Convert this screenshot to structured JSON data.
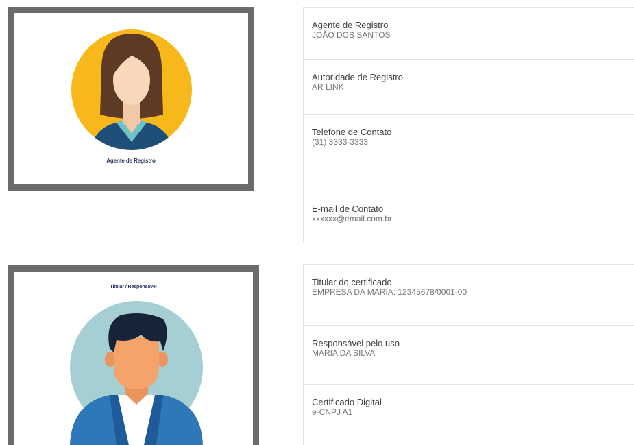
{
  "agent_card": {
    "photo_caption": "Agente de Registro",
    "fields": [
      {
        "label": "Agente de Registro",
        "value": "JOÃO DOS SANTOS"
      },
      {
        "label": "Autoridade de Registro",
        "value": "AR LINK"
      },
      {
        "label": "Telefone de Contato",
        "value": "(31) 3333-3333"
      },
      {
        "label": "E-mail de Contato",
        "value": "xxxxxx@email.com.br"
      }
    ]
  },
  "holder_card": {
    "photo_caption": "Titular / Responsável",
    "fields": [
      {
        "label": "Titular do certificado",
        "value": "EMPRESA DA MARIA: 12345678/0001-00"
      },
      {
        "label": "Responsável pelo uso",
        "value": "MARIA DA SILVA"
      },
      {
        "label": "Certificado Digital",
        "value": "e-CNPJ A1"
      }
    ]
  },
  "colors": {
    "frame_border": "#6b6b6b",
    "agent_avatar_bg": "#f6b81b",
    "holder_avatar_bg": "#a5cfd3",
    "caption_text": "#27365f",
    "panel_border": "#e2e2e2"
  },
  "icons": {
    "agent_photo": "female-avatar-icon",
    "holder_photo": "male-avatar-icon"
  }
}
